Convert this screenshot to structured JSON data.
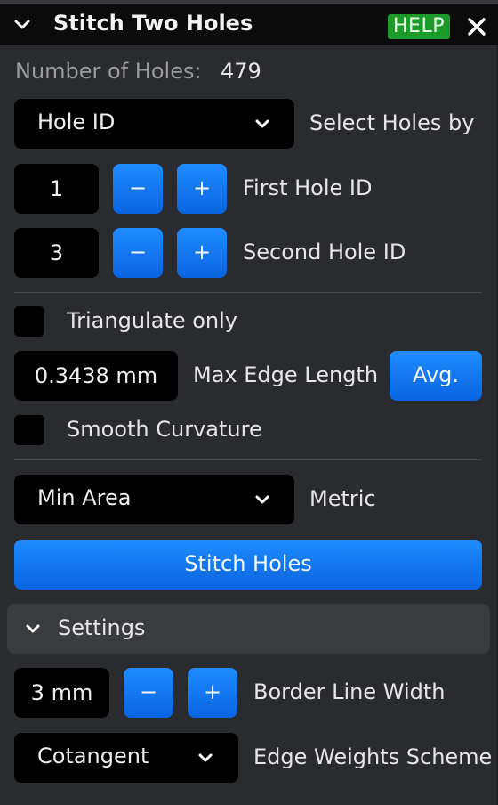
{
  "window": {
    "title": "Stitch Two Holes",
    "help_label": "HELP",
    "colors": {
      "help_bg": "#1c9b2b",
      "accent": "#1f8cff",
      "panel": "#2a2b2e"
    }
  },
  "holes": {
    "count_label": "Number of Holes:",
    "count_value": "479",
    "select_by_value": "Hole ID",
    "select_by_label": "Select Holes by",
    "first_value": "1",
    "first_label": "First Hole ID",
    "second_value": "3",
    "second_label": "Second Hole ID",
    "minus": "−",
    "plus": "+"
  },
  "options": {
    "triangulate_label": "Triangulate only",
    "triangulate_checked": false,
    "max_edge_value": "0.3438 mm",
    "max_edge_label": "Max Edge Length",
    "avg_label": "Avg.",
    "smooth_label": "Smooth Curvature",
    "smooth_checked": false,
    "metric_value": "Min Area",
    "metric_label": "Metric",
    "stitch_label": "Stitch Holes"
  },
  "settings": {
    "header": "Settings",
    "border_value": "3 mm",
    "border_label": "Border Line Width",
    "weights_value": "Cotangent",
    "weights_label": "Edge Weights Scheme"
  },
  "icons": [
    "chevron-down-icon",
    "close-icon",
    "minus-icon",
    "plus-icon"
  ]
}
